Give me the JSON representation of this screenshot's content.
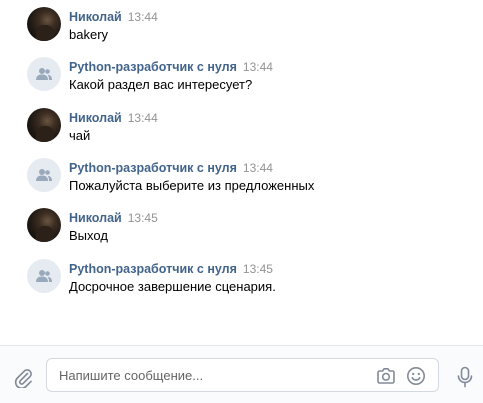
{
  "messages": [
    {
      "author": "Николай",
      "time": "13:44",
      "text": "bakery",
      "avatar": "user-photo"
    },
    {
      "author": "Python-разработчик с нуля",
      "time": "13:44",
      "text": "Какой раздел вас интересует?",
      "avatar": "group-icon"
    },
    {
      "author": "Николай",
      "time": "13:44",
      "text": "чай",
      "avatar": "user-photo"
    },
    {
      "author": "Python-разработчик с нуля",
      "time": "13:44",
      "text": "Пожалуйста выберите из предложенных",
      "avatar": "group-icon"
    },
    {
      "author": "Николай",
      "time": "13:45",
      "text": "Выход",
      "avatar": "user-photo"
    },
    {
      "author": "Python-разработчик с нуля",
      "time": "13:45",
      "text": "Досрочное завершение сценария.",
      "avatar": "group-icon"
    }
  ],
  "composer": {
    "placeholder": "Напишите сообщение...",
    "value": "",
    "icons": [
      "paperclip-icon",
      "camera-icon",
      "emoji-icon",
      "microphone-icon"
    ]
  },
  "colors": {
    "author": "#42648b",
    "time": "#939393",
    "text": "#000000",
    "group_avatar_bg": "#e5ebf1",
    "group_avatar_icon": "#99a9bc",
    "icon": "#828a99",
    "composer_bg": "#fafbfc",
    "input_border": "#d3d9de"
  }
}
